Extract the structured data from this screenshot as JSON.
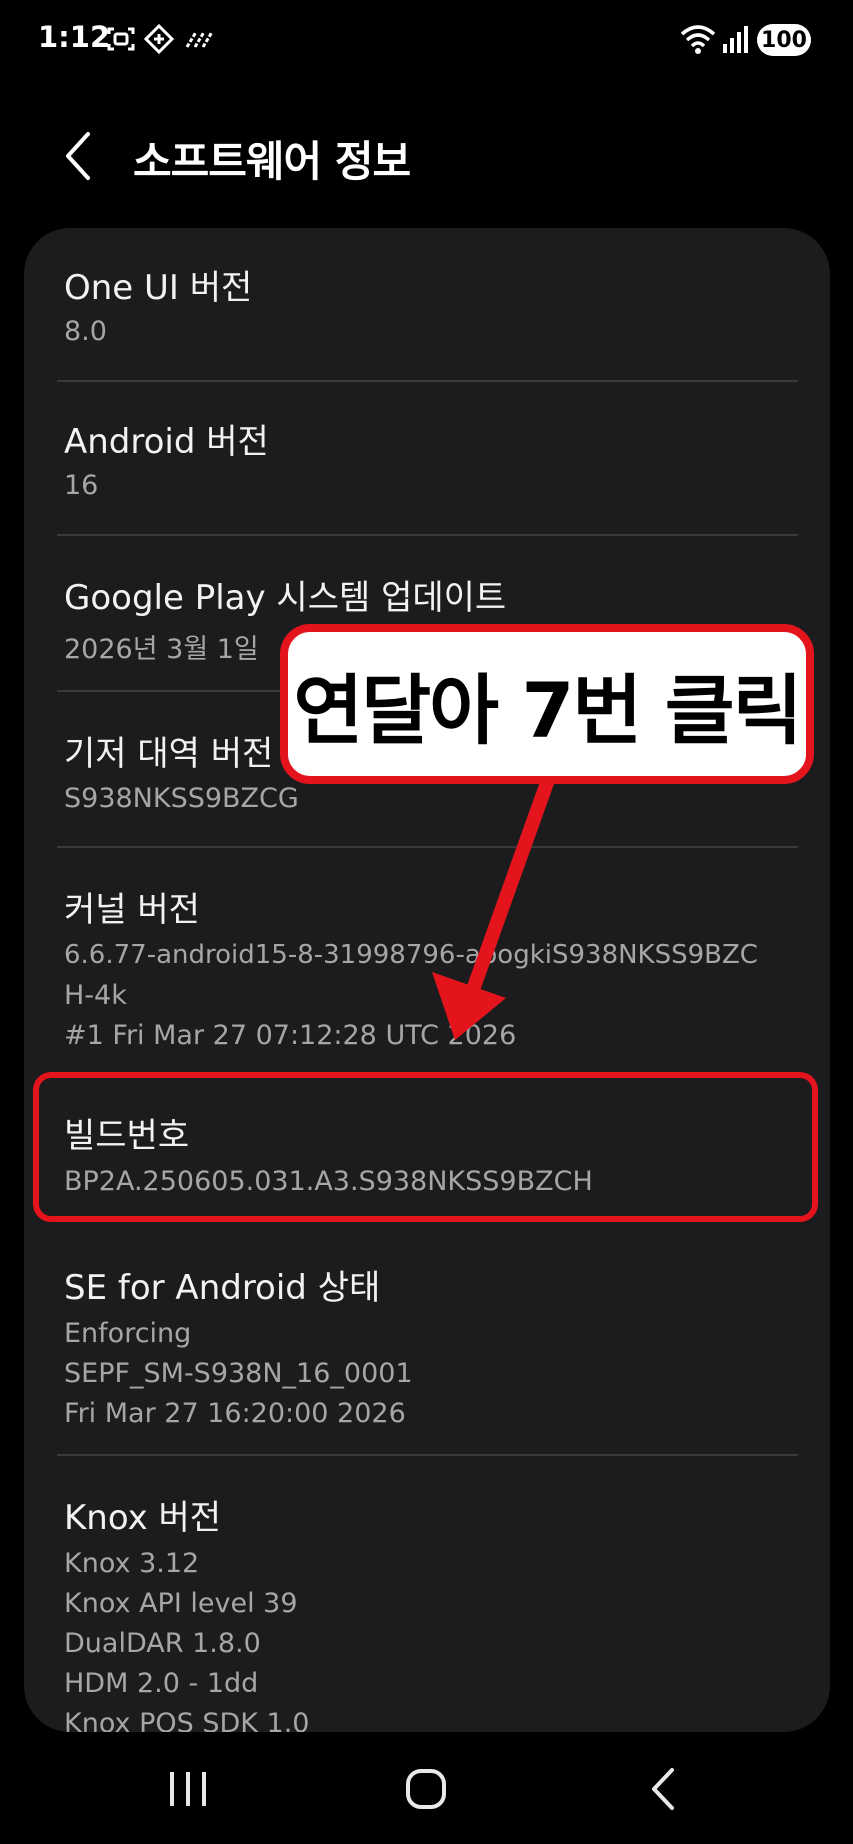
{
  "status_bar": {
    "time": "1:12",
    "battery": "100",
    "icons": [
      "screenshot-icon",
      "vpn-icon",
      "nfc-icon",
      "wifi-icon",
      "signal-icon",
      "battery-icon"
    ]
  },
  "header": {
    "title": "소프트웨어 정보",
    "back_icon": "chevron-left-icon"
  },
  "items": {
    "one_ui": {
      "title": "One UI 버전",
      "lines": [
        "8.0"
      ]
    },
    "android": {
      "title": "Android 버전",
      "lines": [
        "16"
      ]
    },
    "play_system": {
      "title": "Google Play 시스템 업데이트",
      "lines": [
        "2026년 3월 1일"
      ]
    },
    "baseband": {
      "title": "기저 대역 버전",
      "lines": [
        "S938NKSS9BZCG"
      ]
    },
    "kernel": {
      "title": "커널 버전",
      "lines": [
        "6.6.77-android15-8-31998796-abogkiS938NKSS9BZC",
        "H-4k",
        "#1 Fri Mar 27 07:12:28 UTC 2026"
      ]
    },
    "build": {
      "title": "빌드번호",
      "lines": [
        "BP2A.250605.031.A3.S938NKSS9BZCH"
      ]
    },
    "se_android": {
      "title": "SE for Android 상태",
      "lines": [
        "Enforcing",
        "SEPF_SM-S938N_16_0001",
        "Fri Mar 27 16:20:00 2026"
      ]
    },
    "knox": {
      "title": "Knox 버전",
      "lines": [
        "Knox 3.12",
        "Knox API level 39",
        "DualDAR 1.8.0",
        "HDM 2.0 - 1dd",
        "Knox POS SDK 1.0"
      ]
    }
  },
  "annotation": {
    "callout_text": "연달아 7번 클릭",
    "color": "#e3141b"
  },
  "nav_bar": {
    "icons": [
      "recent-apps-icon",
      "home-icon",
      "back-icon"
    ]
  },
  "colors": {
    "background": "#000000",
    "card": "#1c1c1e",
    "title_text": "#f2f2f2",
    "secondary_text": "#a6a6a8",
    "divider": "#3a3a3c"
  }
}
